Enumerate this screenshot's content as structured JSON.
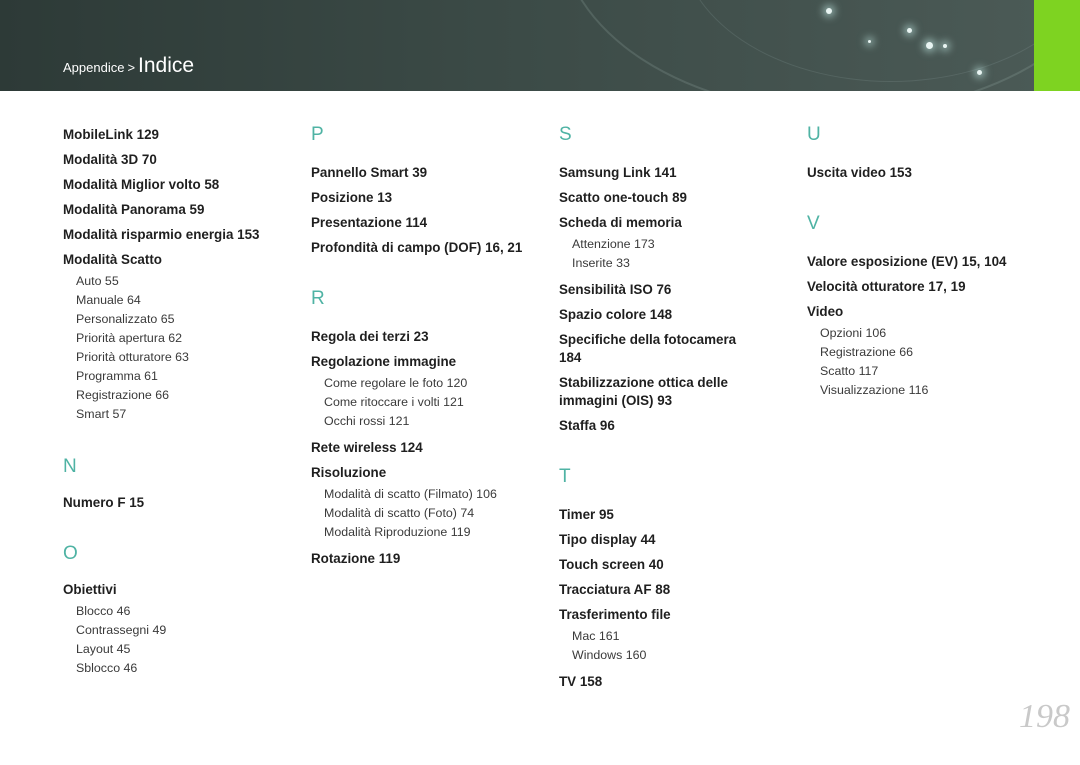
{
  "breadcrumb": {
    "parent": "Appendice",
    "separator": ">",
    "current": "Indice"
  },
  "page_number": "198",
  "col1": {
    "entries_a": [
      "MobileLink  129",
      "Modalità 3D  70",
      "Modalità Miglior volto  58",
      "Modalità Panorama  59",
      "Modalità risparmio energia  153",
      "Modalità Scatto"
    ],
    "scatto_subs": [
      "Auto  55",
      "Manuale  64",
      "Personalizzato  65",
      "Priorità apertura  62",
      "Priorità otturatore  63",
      "Programma  61",
      "Registrazione  66",
      "Smart  57"
    ],
    "letter_n": "N",
    "entries_n": [
      "Numero F  15"
    ],
    "letter_o": "O",
    "entries_o": [
      "Obiettivi"
    ],
    "obiettivi_subs": [
      "Blocco  46",
      "Contrassegni  49",
      "Layout  45",
      "Sblocco  46"
    ]
  },
  "col2": {
    "letter_p": "P",
    "entries_p": [
      "Pannello Smart  39",
      "Posizione  13",
      "Presentazione  114",
      "Profondità di campo (DOF)  16, 21"
    ],
    "letter_r": "R",
    "entries_r1": [
      "Regola dei terzi  23",
      "Regolazione immagine"
    ],
    "regolazione_subs": [
      "Come regolare le foto  120",
      "Come ritoccare i volti  121",
      "Occhi rossi  121"
    ],
    "entries_r2": [
      "Rete wireless  124",
      "Risoluzione"
    ],
    "risoluzione_subs": [
      "Modalità di scatto (Filmato)  106",
      "Modalità di scatto (Foto)  74",
      "Modalità Riproduzione  119"
    ],
    "entries_r3": [
      "Rotazione  119"
    ]
  },
  "col3": {
    "letter_s": "S",
    "entries_s1": [
      "Samsung Link  141",
      "Scatto one-touch  89",
      "Scheda di memoria"
    ],
    "scheda_subs": [
      "Attenzione  173",
      "Inserite  33"
    ],
    "entries_s2": [
      "Sensibilità ISO  76",
      "Spazio colore  148",
      "Specifiche della fotocamera  184",
      "Stabilizzazione ottica delle immagini (OIS)  93",
      "Staffa  96"
    ],
    "letter_t": "T",
    "entries_t1": [
      "Timer  95",
      "Tipo display  44",
      "Touch screen  40",
      "Tracciatura AF  88",
      "Trasferimento file"
    ],
    "trasferimento_subs": [
      "Mac  161",
      "Windows  160"
    ],
    "entries_t2": [
      "TV  158"
    ]
  },
  "col4": {
    "letter_u": "U",
    "entries_u": [
      "Uscita video  153"
    ],
    "letter_v": "V",
    "entries_v": [
      "Valore esposizione (EV)  15, 104",
      "Velocità otturatore  17, 19",
      "Video"
    ],
    "video_subs": [
      "Opzioni  106",
      "Registrazione  66",
      "Scatto  117",
      "Visualizzazione  116"
    ]
  }
}
